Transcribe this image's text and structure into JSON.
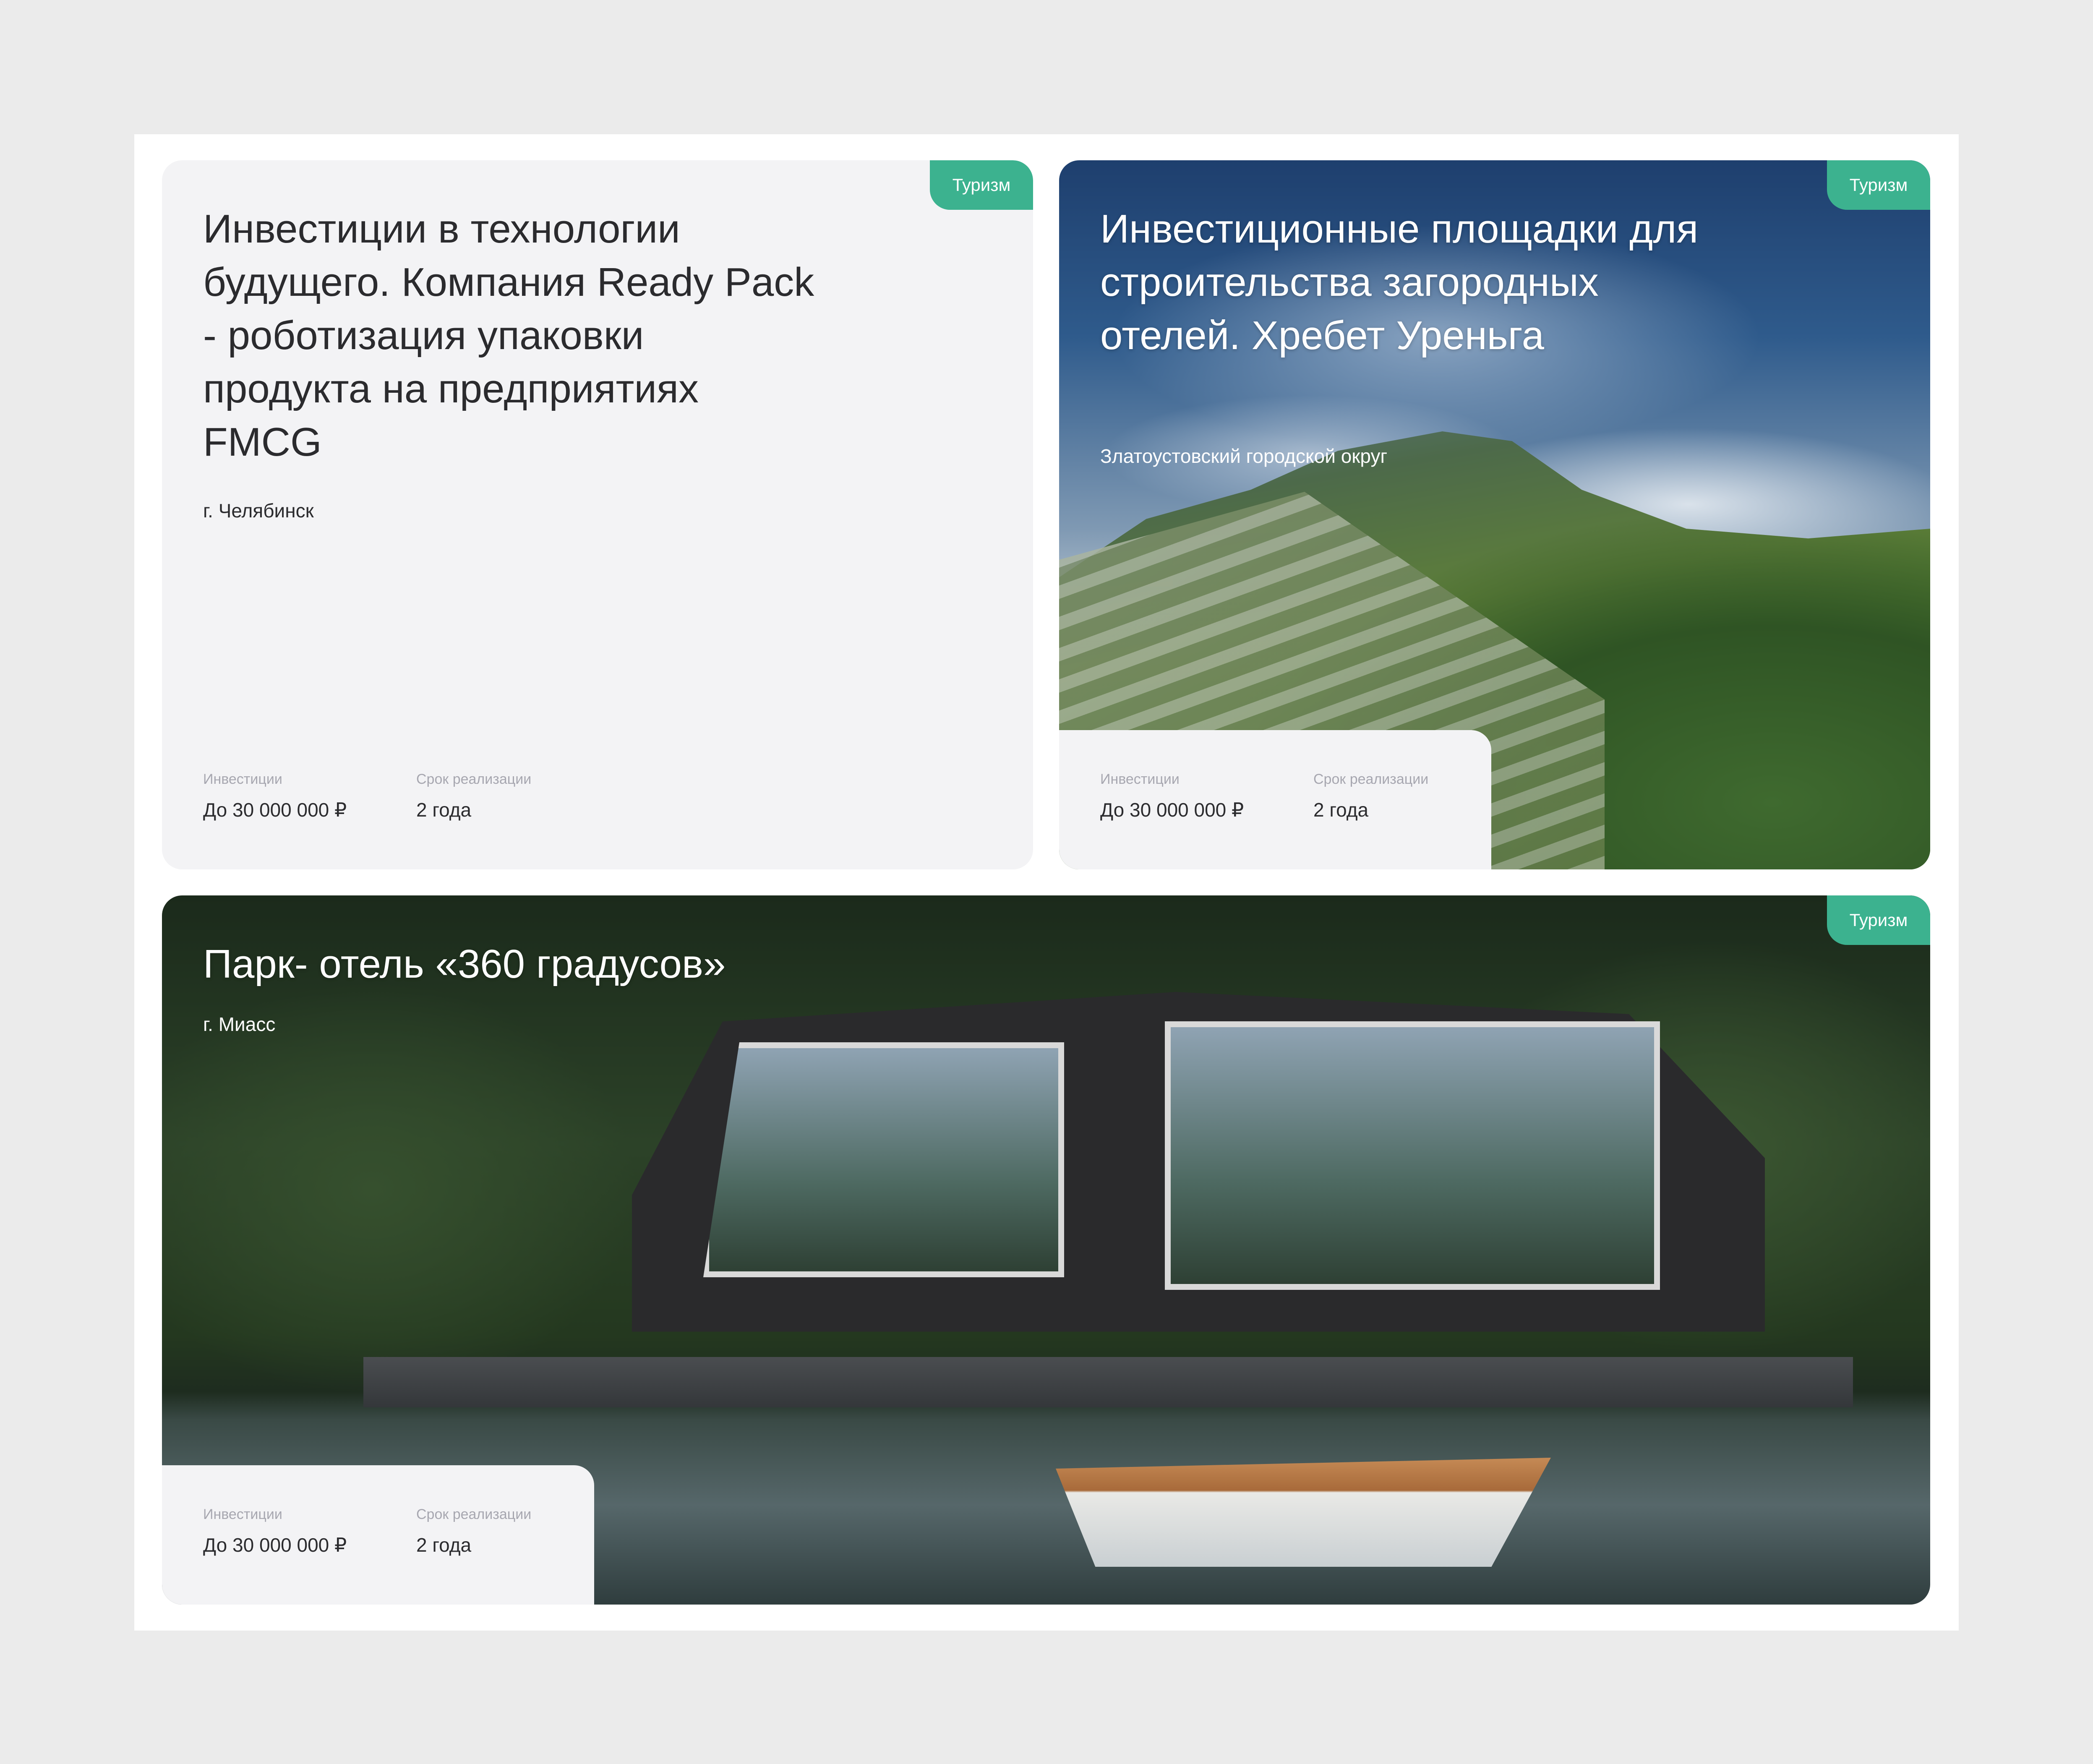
{
  "cards": [
    {
      "tag": "Туризм",
      "title": "Инвестиции в технологии будущего. Компания Ready Pack - роботизация упаковки продукта на предприятиях FMCG",
      "location": "г. Челябинск",
      "investments_label": "Инвестиции",
      "investments_value": "До 30 000 000 ₽",
      "term_label": "Срок реализации",
      "term_value": "2 года"
    },
    {
      "tag": "Туризм",
      "title": "Инвестиционные площадки для строительства загородных отелей. Хребет Уреньга",
      "location": "Златоустовский городской округ",
      "investments_label": "Инвестиции",
      "investments_value": "До 30 000 000 ₽",
      "term_label": "Срок реализации",
      "term_value": "2 года"
    },
    {
      "tag": "Туризм",
      "title": "Парк- отель «360 градусов»",
      "location": "г. Миасс",
      "investments_label": "Инвестиции",
      "investments_value": "До 30 000 000 ₽",
      "term_label": "Срок реализации",
      "term_value": "2 года"
    }
  ]
}
